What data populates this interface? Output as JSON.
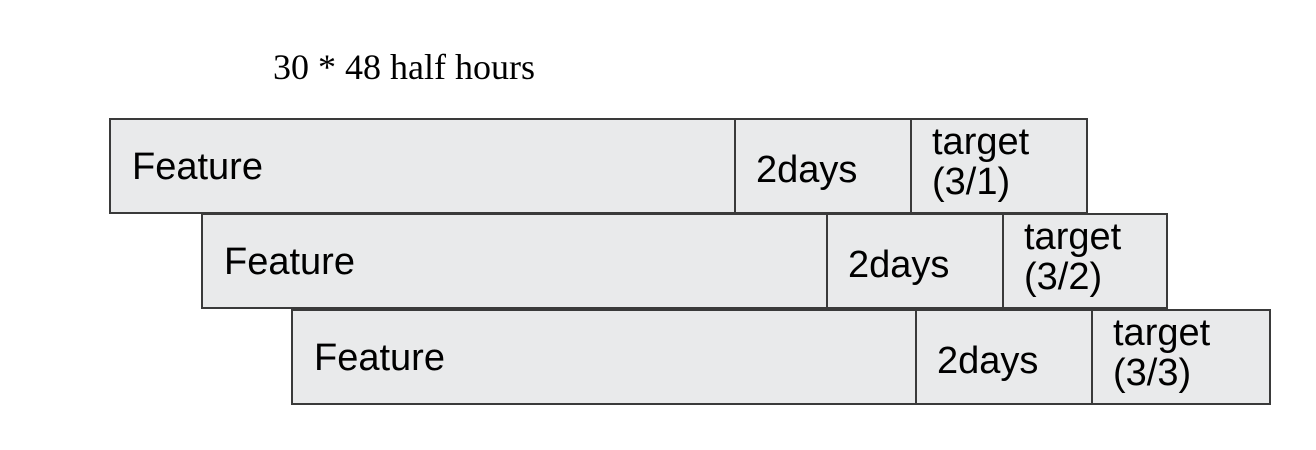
{
  "caption": "30 * 48 half hours",
  "rows": [
    {
      "feature_label": "Feature",
      "days_label": "2days",
      "target_label": "target\n(3/1)"
    },
    {
      "feature_label": "Feature",
      "days_label": "2days",
      "target_label": "target\n(3/2)"
    },
    {
      "feature_label": "Feature",
      "days_label": "2days",
      "target_label": "target\n(3/3)"
    }
  ],
  "colors": {
    "cell_fill": "#e9eaeb",
    "cell_border": "#3a3a3a",
    "text": "#000000"
  }
}
